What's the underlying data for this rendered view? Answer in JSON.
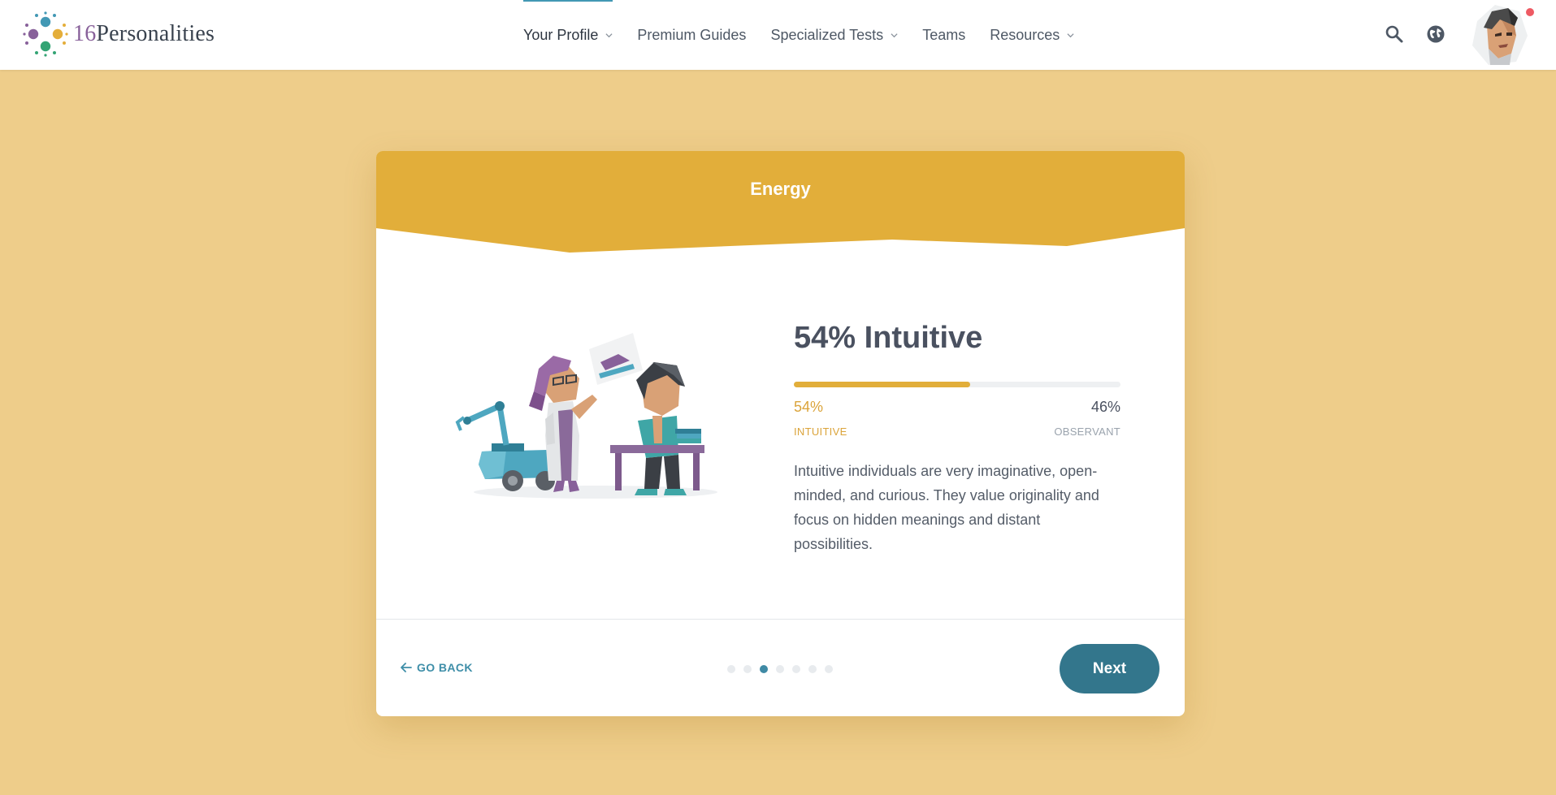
{
  "brand": {
    "number": "16",
    "name": "Personalities"
  },
  "nav": {
    "items": [
      {
        "label": "Your Profile",
        "dropdown": true,
        "active": true
      },
      {
        "label": "Premium Guides",
        "dropdown": false
      },
      {
        "label": "Specialized Tests",
        "dropdown": true
      },
      {
        "label": "Teams",
        "dropdown": false
      },
      {
        "label": "Resources",
        "dropdown": true
      }
    ]
  },
  "header_icons": [
    "search-icon",
    "globe-icon",
    "avatar"
  ],
  "card": {
    "title": "Energy",
    "heading": "54% Intuitive",
    "progress_fraction": 0.54,
    "left_trait": {
      "percent": "54%",
      "label": "INTUITIVE"
    },
    "right_trait": {
      "percent": "46%",
      "label": "OBSERVANT"
    },
    "description": "Intuitive individuals are very imaginative, open-minded, and curious. They value originality and focus on hidden meanings and distant possibilities.",
    "go_back": "GO BACK",
    "next": "Next",
    "steps_total": 7,
    "steps_current": 3
  },
  "colors": {
    "background": "#eecd8a",
    "header_band": "#e2ae3a",
    "accent": "#33768c",
    "intuitive": "#dba43b"
  }
}
